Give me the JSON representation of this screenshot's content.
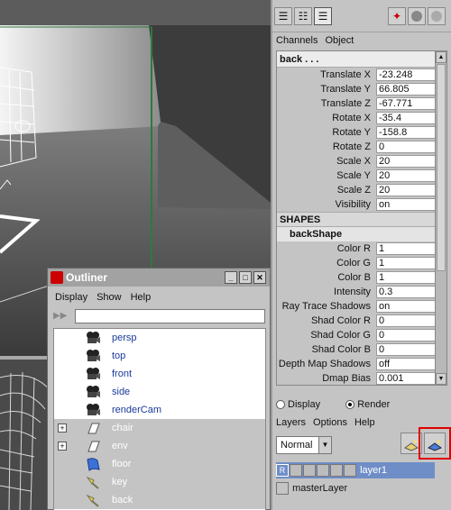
{
  "channel_box": {
    "menu": [
      "Channels",
      "Object"
    ],
    "object_name": "back . . .",
    "transform_rows": [
      {
        "label": "Translate X",
        "value": "-23.248"
      },
      {
        "label": "Translate Y",
        "value": "66.805"
      },
      {
        "label": "Translate Z",
        "value": "-67.771"
      },
      {
        "label": "Rotate X",
        "value": "-35.4"
      },
      {
        "label": "Rotate Y",
        "value": "-158.8"
      },
      {
        "label": "Rotate Z",
        "value": "0"
      },
      {
        "label": "Scale X",
        "value": "20"
      },
      {
        "label": "Scale Y",
        "value": "20"
      },
      {
        "label": "Scale Z",
        "value": "20"
      },
      {
        "label": "Visibility",
        "value": "on"
      }
    ],
    "shapes_header": "SHAPES",
    "shape_name": "backShape",
    "shape_rows": [
      {
        "label": "Color R",
        "value": "1"
      },
      {
        "label": "Color G",
        "value": "1"
      },
      {
        "label": "Color B",
        "value": "1"
      },
      {
        "label": "Intensity",
        "value": "0.3"
      },
      {
        "label": "Ray Trace Shadows",
        "value": "on"
      },
      {
        "label": "Shad Color R",
        "value": "0"
      },
      {
        "label": "Shad Color G",
        "value": "0"
      },
      {
        "label": "Shad Color B",
        "value": "0"
      },
      {
        "label": "Depth Map Shadows",
        "value": "off"
      },
      {
        "label": "Dmap Bias",
        "value": "0.001"
      }
    ]
  },
  "layer_editor": {
    "radio_display": "Display",
    "radio_render": "Render",
    "menu": [
      "Layers",
      "Options",
      "Help"
    ],
    "blend_mode": "Normal",
    "layers": [
      {
        "flag": "R",
        "name": "layer1",
        "selected": true
      },
      {
        "flag": "",
        "name": "masterLayer",
        "selected": false
      }
    ]
  },
  "outliner": {
    "title": "Outliner",
    "menu": [
      "Display",
      "Show",
      "Help"
    ],
    "items": [
      {
        "name": "persp",
        "type": "camera",
        "expandable": false
      },
      {
        "name": "top",
        "type": "camera",
        "expandable": false
      },
      {
        "name": "front",
        "type": "camera",
        "expandable": false
      },
      {
        "name": "side",
        "type": "camera",
        "expandable": false
      },
      {
        "name": "renderCam",
        "type": "camera",
        "expandable": false
      },
      {
        "name": "chair",
        "type": "group",
        "expandable": true
      },
      {
        "name": "env",
        "type": "group",
        "expandable": true
      },
      {
        "name": "floor",
        "type": "plane",
        "expandable": false
      },
      {
        "name": "key",
        "type": "light",
        "expandable": false
      },
      {
        "name": "back",
        "type": "light",
        "expandable": false
      }
    ]
  },
  "colors": {
    "panel": "#c4c4c4",
    "selection": "#6f8ec7",
    "highlight_box": "#e00000",
    "outliner_text": "#1a3a9a"
  }
}
